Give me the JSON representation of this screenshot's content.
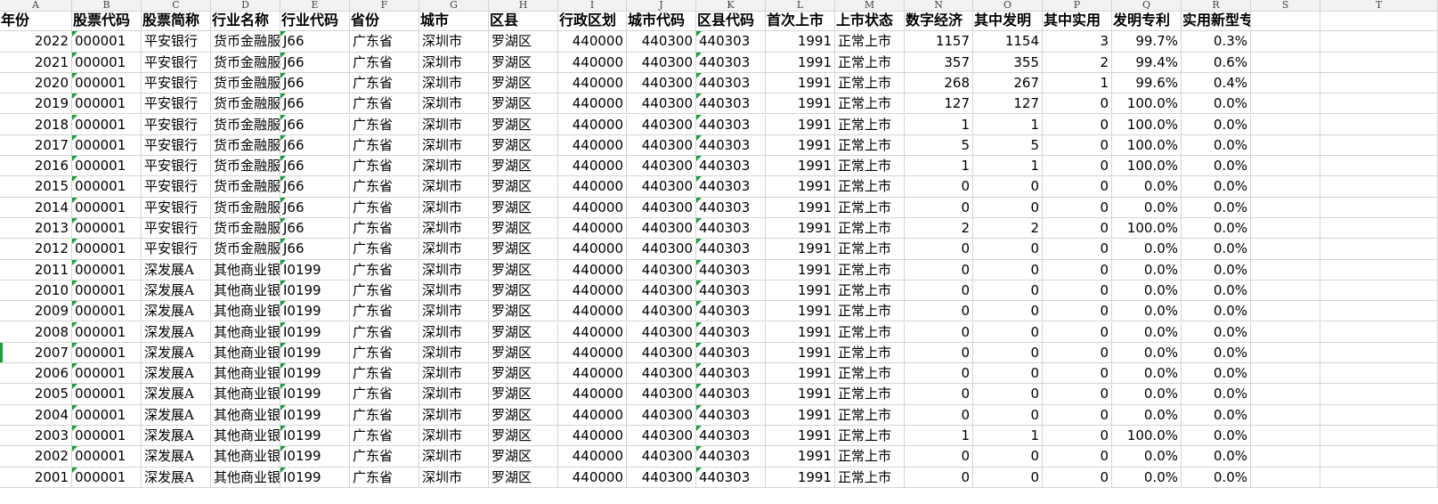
{
  "columns": [
    "A",
    "B",
    "C",
    "D",
    "E",
    "F",
    "G",
    "H",
    "I",
    "J",
    "K",
    "L",
    "M",
    "N",
    "O",
    "P",
    "Q",
    "R",
    "S",
    "T"
  ],
  "headers": [
    "年份",
    "股票代码",
    "股票简称",
    "行业名称",
    "行业代码",
    "省份",
    "城市",
    "区县",
    "行政区划",
    "城市代码",
    "区县代码",
    "首次上市",
    "上市状态",
    "数字经济",
    "其中发明",
    "其中实用",
    "发明专利",
    "实用新型专利占比"
  ],
  "rows": [
    [
      "2022",
      "000001",
      "平安银行",
      "货币金融服务",
      "J66",
      "广东省",
      "深圳市",
      "罗湖区",
      "440000",
      "440300",
      "440303",
      "1991",
      "正常上市",
      "1157",
      "1154",
      "3",
      "99.7%",
      "0.3%"
    ],
    [
      "2021",
      "000001",
      "平安银行",
      "货币金融服务",
      "J66",
      "广东省",
      "深圳市",
      "罗湖区",
      "440000",
      "440300",
      "440303",
      "1991",
      "正常上市",
      "357",
      "355",
      "2",
      "99.4%",
      "0.6%"
    ],
    [
      "2020",
      "000001",
      "平安银行",
      "货币金融服务",
      "J66",
      "广东省",
      "深圳市",
      "罗湖区",
      "440000",
      "440300",
      "440303",
      "1991",
      "正常上市",
      "268",
      "267",
      "1",
      "99.6%",
      "0.4%"
    ],
    [
      "2019",
      "000001",
      "平安银行",
      "货币金融服务",
      "J66",
      "广东省",
      "深圳市",
      "罗湖区",
      "440000",
      "440300",
      "440303",
      "1991",
      "正常上市",
      "127",
      "127",
      "0",
      "100.0%",
      "0.0%"
    ],
    [
      "2018",
      "000001",
      "平安银行",
      "货币金融服务",
      "J66",
      "广东省",
      "深圳市",
      "罗湖区",
      "440000",
      "440300",
      "440303",
      "1991",
      "正常上市",
      "1",
      "1",
      "0",
      "100.0%",
      "0.0%"
    ],
    [
      "2017",
      "000001",
      "平安银行",
      "货币金融服务",
      "J66",
      "广东省",
      "深圳市",
      "罗湖区",
      "440000",
      "440300",
      "440303",
      "1991",
      "正常上市",
      "5",
      "5",
      "0",
      "100.0%",
      "0.0%"
    ],
    [
      "2016",
      "000001",
      "平安银行",
      "货币金融服务",
      "J66",
      "广东省",
      "深圳市",
      "罗湖区",
      "440000",
      "440300",
      "440303",
      "1991",
      "正常上市",
      "1",
      "1",
      "0",
      "100.0%",
      "0.0%"
    ],
    [
      "2015",
      "000001",
      "平安银行",
      "货币金融服务",
      "J66",
      "广东省",
      "深圳市",
      "罗湖区",
      "440000",
      "440300",
      "440303",
      "1991",
      "正常上市",
      "0",
      "0",
      "0",
      "0.0%",
      "0.0%"
    ],
    [
      "2014",
      "000001",
      "平安银行",
      "货币金融服务",
      "J66",
      "广东省",
      "深圳市",
      "罗湖区",
      "440000",
      "440300",
      "440303",
      "1991",
      "正常上市",
      "0",
      "0",
      "0",
      "0.0%",
      "0.0%"
    ],
    [
      "2013",
      "000001",
      "平安银行",
      "货币金融服务",
      "J66",
      "广东省",
      "深圳市",
      "罗湖区",
      "440000",
      "440300",
      "440303",
      "1991",
      "正常上市",
      "2",
      "2",
      "0",
      "100.0%",
      "0.0%"
    ],
    [
      "2012",
      "000001",
      "平安银行",
      "货币金融服务",
      "J66",
      "广东省",
      "深圳市",
      "罗湖区",
      "440000",
      "440300",
      "440303",
      "1991",
      "正常上市",
      "0",
      "0",
      "0",
      "0.0%",
      "0.0%"
    ],
    [
      "2011",
      "000001",
      "深发展A",
      "其他商业银行",
      "I0199",
      "广东省",
      "深圳市",
      "罗湖区",
      "440000",
      "440300",
      "440303",
      "1991",
      "正常上市",
      "0",
      "0",
      "0",
      "0.0%",
      "0.0%"
    ],
    [
      "2010",
      "000001",
      "深发展A",
      "其他商业银行",
      "I0199",
      "广东省",
      "深圳市",
      "罗湖区",
      "440000",
      "440300",
      "440303",
      "1991",
      "正常上市",
      "0",
      "0",
      "0",
      "0.0%",
      "0.0%"
    ],
    [
      "2009",
      "000001",
      "深发展A",
      "其他商业银行",
      "I0199",
      "广东省",
      "深圳市",
      "罗湖区",
      "440000",
      "440300",
      "440303",
      "1991",
      "正常上市",
      "0",
      "0",
      "0",
      "0.0%",
      "0.0%"
    ],
    [
      "2008",
      "000001",
      "深发展A",
      "其他商业银行",
      "I0199",
      "广东省",
      "深圳市",
      "罗湖区",
      "440000",
      "440300",
      "440303",
      "1991",
      "正常上市",
      "0",
      "0",
      "0",
      "0.0%",
      "0.0%"
    ],
    [
      "2007",
      "000001",
      "深发展A",
      "其他商业银行",
      "I0199",
      "广东省",
      "深圳市",
      "罗湖区",
      "440000",
      "440300",
      "440303",
      "1991",
      "正常上市",
      "0",
      "0",
      "0",
      "0.0%",
      "0.0%"
    ],
    [
      "2006",
      "000001",
      "深发展A",
      "其他商业银行",
      "I0199",
      "广东省",
      "深圳市",
      "罗湖区",
      "440000",
      "440300",
      "440303",
      "1991",
      "正常上市",
      "0",
      "0",
      "0",
      "0.0%",
      "0.0%"
    ],
    [
      "2005",
      "000001",
      "深发展A",
      "其他商业银行",
      "I0199",
      "广东省",
      "深圳市",
      "罗湖区",
      "440000",
      "440300",
      "440303",
      "1991",
      "正常上市",
      "0",
      "0",
      "0",
      "0.0%",
      "0.0%"
    ],
    [
      "2004",
      "000001",
      "深发展A",
      "其他商业银行",
      "I0199",
      "广东省",
      "深圳市",
      "罗湖区",
      "440000",
      "440300",
      "440303",
      "1991",
      "正常上市",
      "0",
      "0",
      "0",
      "0.0%",
      "0.0%"
    ],
    [
      "2003",
      "000001",
      "深发展A",
      "其他商业银行",
      "I0199",
      "广东省",
      "深圳市",
      "罗湖区",
      "440000",
      "440300",
      "440303",
      "1991",
      "正常上市",
      "1",
      "1",
      "0",
      "100.0%",
      "0.0%"
    ],
    [
      "2002",
      "000001",
      "深发展A",
      "其他商业银行",
      "I0199",
      "广东省",
      "深圳市",
      "罗湖区",
      "440000",
      "440300",
      "440303",
      "1991",
      "正常上市",
      "0",
      "0",
      "0",
      "0.0%",
      "0.0%"
    ],
    [
      "2001",
      "000001",
      "深发展A",
      "其他商业银行",
      "I0199",
      "广东省",
      "深圳市",
      "罗湖区",
      "440000",
      "440300",
      "440303",
      "1991",
      "正常上市",
      "0",
      "0",
      "0",
      "0.0%",
      "0.0%"
    ]
  ],
  "colors": {
    "flag": "#1a9e3a",
    "gridline": "#d4d4d4",
    "header_bg": "#f2f2f2"
  }
}
